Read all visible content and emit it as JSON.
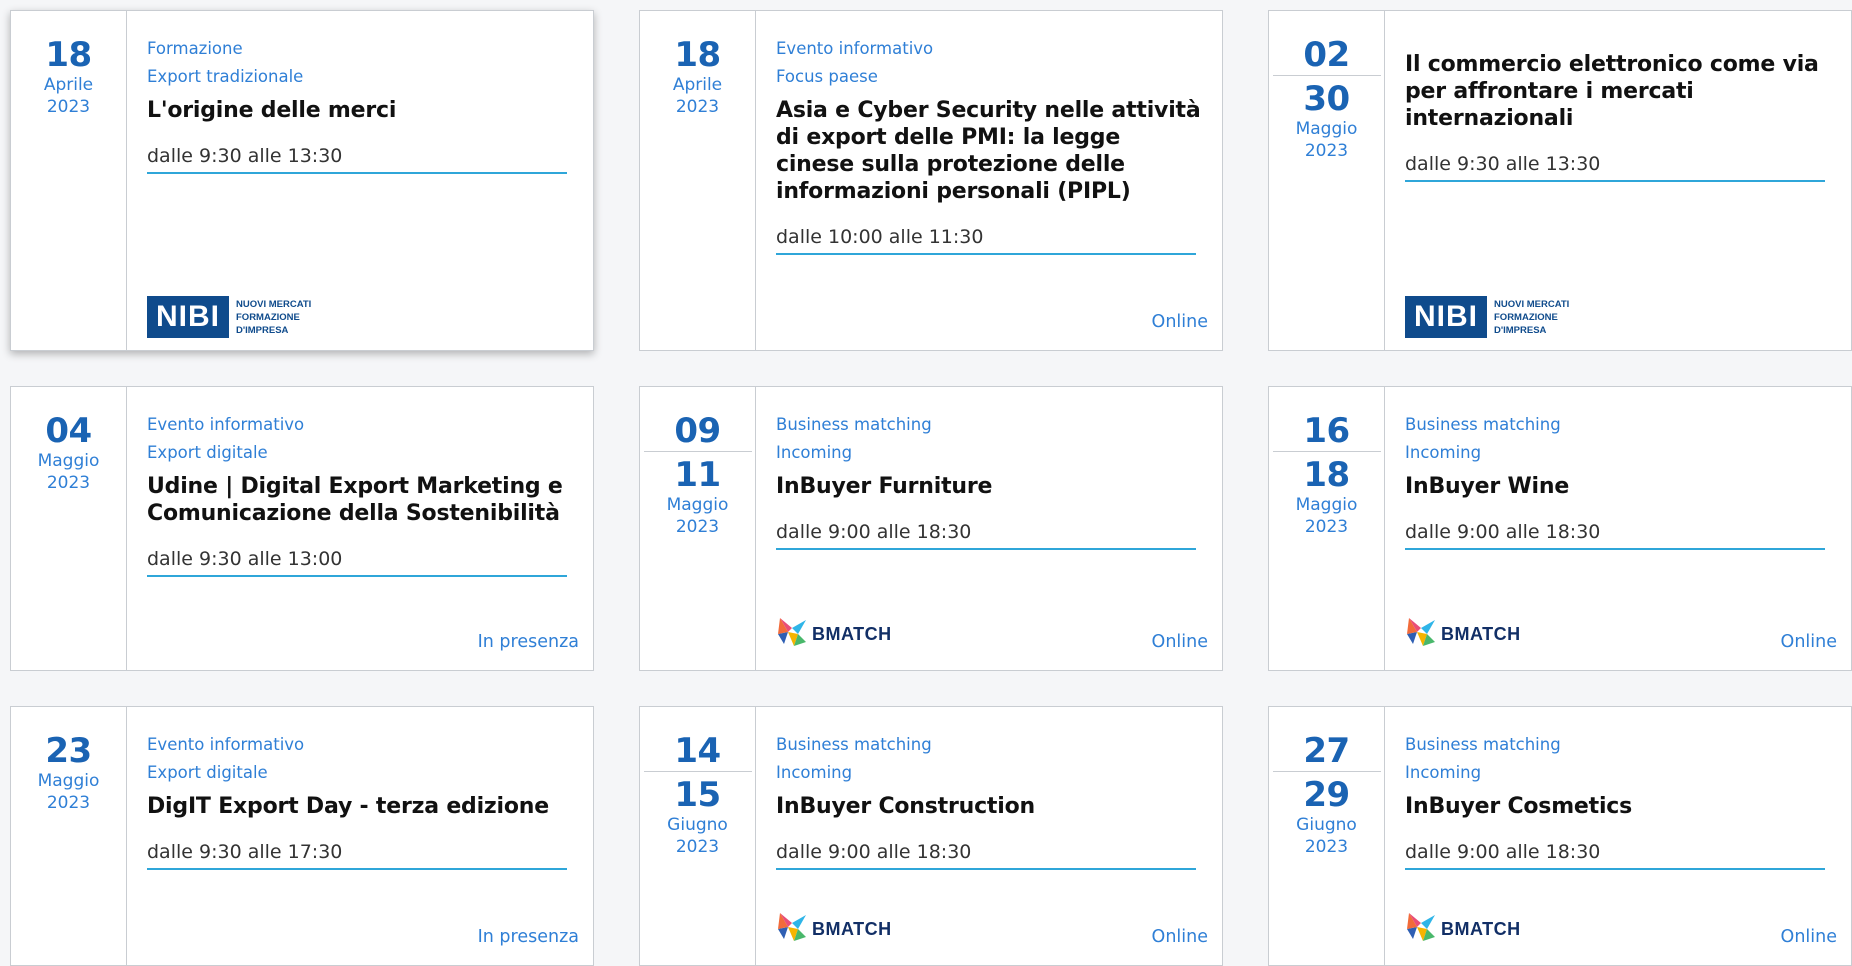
{
  "events": [
    {
      "start_day": "18",
      "end_day": "",
      "month": "Aprile",
      "year": "2023",
      "category": "Formazione",
      "subcategory": "Export tradizionale",
      "title": "L'origine delle merci",
      "time": "dalle 9:30 alle 13:30",
      "mode": "",
      "logo": "nibi-logo"
    },
    {
      "start_day": "18",
      "end_day": "",
      "month": "Aprile",
      "year": "2023",
      "category": "Evento informativo",
      "subcategory": "Focus paese",
      "title": "Asia e Cyber Security nelle attività di export delle PMI: la legge cinese sulla protezione delle informazioni personali (PIPL)",
      "time": "dalle 10:00 alle 11:30",
      "mode": "Online",
      "logo": ""
    },
    {
      "start_day": "02",
      "end_day": "30",
      "month": "Maggio",
      "year": "2023",
      "category": "",
      "subcategory": "",
      "title": "Il commercio elettronico come via per affrontare i mercati internazionali",
      "time": "dalle 9:30 alle 13:30",
      "mode": "",
      "logo": "nibi-logo"
    },
    {
      "start_day": "04",
      "end_day": "",
      "month": "Maggio",
      "year": "2023",
      "category": "Evento informativo",
      "subcategory": "Export digitale",
      "title": "Udine | Digital Export Marketing e Comunicazione della Sostenibilità",
      "time": "dalle 9:30 alle 13:00",
      "mode": "In presenza",
      "logo": ""
    },
    {
      "start_day": "09",
      "end_day": "11",
      "month": "Maggio",
      "year": "2023",
      "category": "Business matching",
      "subcategory": "Incoming",
      "title": "InBuyer Furniture",
      "time": "dalle 9:00 alle 18:30",
      "mode": "Online",
      "logo": "bmatch-logo"
    },
    {
      "start_day": "16",
      "end_day": "18",
      "month": "Maggio",
      "year": "2023",
      "category": "Business matching",
      "subcategory": "Incoming",
      "title": "InBuyer Wine",
      "time": "dalle 9:00 alle 18:30",
      "mode": "Online",
      "logo": "bmatch-logo"
    },
    {
      "start_day": "23",
      "end_day": "",
      "month": "Maggio",
      "year": "2023",
      "category": "Evento informativo",
      "subcategory": "Export digitale",
      "title": "DigIT Export Day - terza edizione",
      "time": "dalle 9:30 alle 17:30",
      "mode": "In presenza",
      "logo": ""
    },
    {
      "start_day": "14",
      "end_day": "15",
      "month": "Giugno",
      "year": "2023",
      "category": "Business matching",
      "subcategory": "Incoming",
      "title": "InBuyer Construction",
      "time": "dalle 9:00 alle 18:30",
      "mode": "Online",
      "logo": "bmatch-logo"
    },
    {
      "start_day": "27",
      "end_day": "29",
      "month": "Giugno",
      "year": "2023",
      "category": "Business matching",
      "subcategory": "Incoming",
      "title": "InBuyer Cosmetics",
      "time": "dalle 9:00 alle 18:30",
      "mode": "Online",
      "logo": "bmatch-logo"
    }
  ],
  "logos": {
    "nibi": {
      "mark": "NIBI",
      "tagline": [
        "NUOVI MERCATI",
        "FORMAZIONE",
        "D'IMPRESA"
      ]
    },
    "bmatch": {
      "mark": "BMATCH"
    }
  },
  "colors": {
    "accent": "#2f7fd6",
    "date": "#1a63b3",
    "rule": "#2fa6d9",
    "nibi": "#0f4b8c",
    "bmatch": "#122f66"
  }
}
